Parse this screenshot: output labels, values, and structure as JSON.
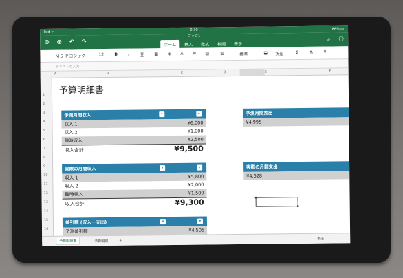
{
  "status": {
    "carrier": "iPad ≈",
    "time": "0:30",
    "battery": "88% ▭"
  },
  "app": {
    "doc_name": "ブック1"
  },
  "tabs": [
    "ホーム",
    "挿入",
    "数式",
    "校閲",
    "表示"
  ],
  "ribbon": {
    "font": "ＭＳ Ｐゴシック",
    "size": "12",
    "bold": "B",
    "italic": "I",
    "underline": "U",
    "format": "標準",
    "wrap": "折返"
  },
  "formula_bar": {
    "placeholder": "テキストの入力"
  },
  "columns": [
    "A",
    "B",
    "C",
    "D",
    "E",
    "F"
  ],
  "rows": [
    "1",
    "2",
    "3",
    "4",
    "5",
    "6",
    "7",
    "8",
    "9",
    "10",
    "11",
    "12",
    "13",
    "14",
    "15",
    "16"
  ],
  "sheet_title": "予算明細書",
  "income": {
    "header": "予測月間収入",
    "rows": [
      {
        "label": "収入 1",
        "value": "¥6,000"
      },
      {
        "label": "収入 2",
        "value": "¥1,000"
      },
      {
        "label": "臨時収入",
        "value": "¥2,500"
      }
    ],
    "total_label": "収入合計",
    "total_value": "¥9,500"
  },
  "actual_income": {
    "header": "実際の月間収入",
    "rows": [
      {
        "label": "収入 1",
        "value": "¥5,800"
      },
      {
        "label": "収入 2",
        "value": "¥2,000"
      },
      {
        "label": "臨時収入",
        "value": "¥1,500"
      }
    ],
    "total_label": "収入合計",
    "total_value": "¥9,300"
  },
  "diff": {
    "header": "差引額 (収入－支出)",
    "row_label": "予測差引額",
    "row_value": "¥4,505"
  },
  "expense_pred": {
    "header": "予測月間支出",
    "value": "¥4,995"
  },
  "expense_actual": {
    "header": "実際の月間支出",
    "value": "¥4,628"
  },
  "sheets": {
    "active": "予算明細書",
    "other": "予算明細",
    "add": "+",
    "right": "表示"
  }
}
